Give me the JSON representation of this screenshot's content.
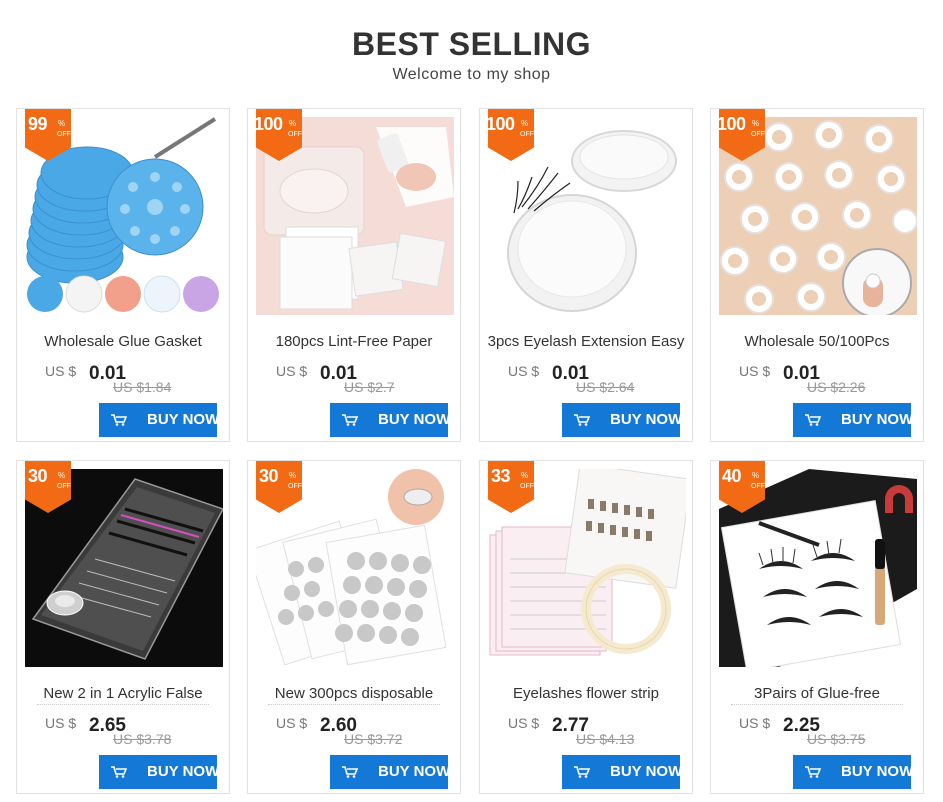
{
  "header": {
    "title": "BEST SELLING",
    "subtitle": "Welcome to my shop"
  },
  "currency": "US $",
  "buy_label": "BUY NOW",
  "off_label": "OFF",
  "pct_symbol": "%",
  "products": [
    {
      "discount": "99",
      "name": "Wholesale Glue Gasket",
      "price": "0.01",
      "old_price": "US $1.84"
    },
    {
      "discount": "100",
      "name": "180pcs Lint-Free Paper",
      "price": "0.01",
      "old_price": "US $2.7"
    },
    {
      "discount": "100",
      "name": "3pcs Eyelash Extension Easy",
      "price": "0.01",
      "old_price": "US $2.64"
    },
    {
      "discount": "100",
      "name": "Wholesale 50/100Pcs",
      "price": "0.01",
      "old_price": "US $2.26"
    },
    {
      "discount": "30",
      "name": "New 2 in 1 Acrylic False",
      "price": "2.65",
      "old_price": "US $3.78"
    },
    {
      "discount": "30",
      "name": "New 300pcs disposable",
      "price": "2.60",
      "old_price": "US $3.72"
    },
    {
      "discount": "33",
      "name": "Eyelashes flower strip",
      "price": "2.77",
      "old_price": "US $4.13"
    },
    {
      "discount": "40",
      "name": "3Pairs of Glue-free",
      "price": "2.25",
      "old_price": "US $3.75"
    }
  ],
  "colors": {
    "badge": "#f26a14",
    "button": "#1479d6"
  }
}
